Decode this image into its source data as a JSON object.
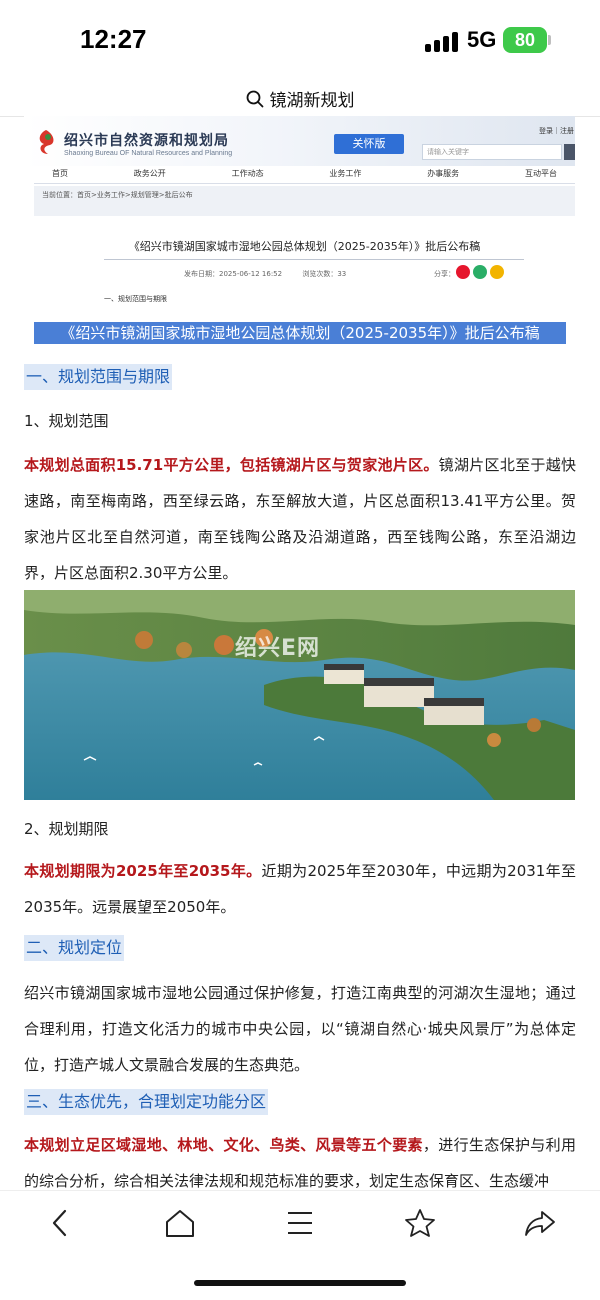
{
  "status": {
    "time": "12:27",
    "network": "5G",
    "battery": "80"
  },
  "search": {
    "query": "镜湖新规划"
  },
  "site": {
    "title": "绍兴市自然资源和规划局",
    "subtitle": "Shaoxing Bureau OF Natural Resources and Planning",
    "care_button": "关怀版",
    "search_placeholder": "请输入关键字",
    "login": "登录｜注册",
    "nav": [
      "首页",
      "政务公开",
      "工作动态",
      "业务工作",
      "办事服务",
      "互动平台"
    ],
    "breadcrumb": "当前位置：首页>业务工作>规划管理>批后公布",
    "article_title": "《绍兴市镜湖国家城市湿地公园总体规划（2025-2035年）》批后公布稿",
    "publish_date": "发布日期：2025-06-12 16:52",
    "views": "浏览次数：33",
    "share_label": "分享：",
    "section": "一、规划范围与期限"
  },
  "article": {
    "title": "《绍兴市镜湖国家城市湿地公园总体规划（2025-2035年）》批后公布稿",
    "h1": "一、规划范围与期限",
    "sub1": "1、规划范围",
    "p1_red": "本规划总面积15.71平方公里，包括镜湖片区与贺家池片区。",
    "p1_rest": "镜湖片区北至于越快速路，南至梅南路，西至绿云路，东至解放大道，片区总面积13.41平方公里。贺家池片区北至自然河道，南至钱陶公路及沿湖道路，西至钱陶公路，东至沿湖边界，片区总面积2.30平方公里。",
    "image_watermark": "绍兴E网",
    "sub2": "2、规划期限",
    "p2_red": "本规划期限为2025年至2035年。",
    "p2_rest": "近期为2025年至2030年，中远期为2031年至2035年。远景展望至2050年。",
    "h2": "二、规划定位",
    "p3": "绍兴市镜湖国家城市湿地公园通过保护修复，打造江南典型的河湖次生湿地；通过合理利用，打造文化活力的城市中央公园，以“镜湖自然心·城央风景厅”为总体定位，打造产城人文景融合发展的生态典范。",
    "h3": "三、生态优先，合理划定功能分区",
    "p4_red": "本规划立足区域湿地、林地、文化、鸟类、风景等五个要素",
    "p4_rest": "，进行生态保护与利用的综合分析，综合相关法律法规和规范标准的要求，划定生态保育区、生态缓冲"
  },
  "bottom_nav": {
    "icons": [
      "back-icon",
      "home-icon",
      "menu-icon",
      "star-icon",
      "share-icon"
    ]
  },
  "colors": {
    "accent_red": "#b5181c",
    "heading_blue": "#1f5fb5",
    "heading_bg": "#dde8f7",
    "title_highlight": "#4a7fd6",
    "battery_green": "#3ec94a"
  }
}
